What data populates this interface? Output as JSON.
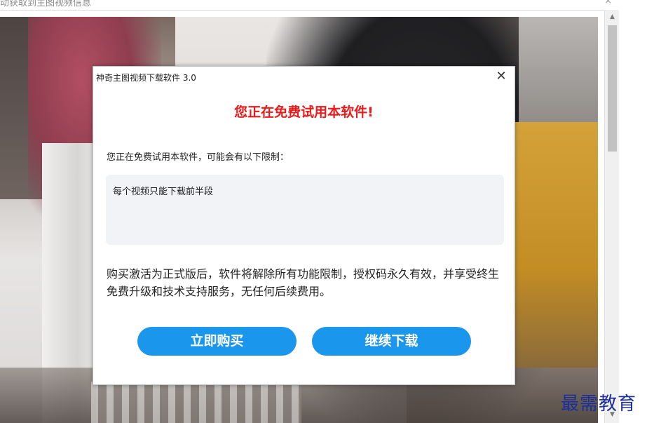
{
  "outer_window": {
    "title": "动获取到主图视频信息",
    "close_glyph": "×"
  },
  "scrollbar": {
    "up_glyph": "▲",
    "down_glyph": "▼"
  },
  "dialog": {
    "title": "神奇主图视频下载软件 3.0",
    "close_glyph": "✕",
    "headline": "您正在免费试用本软件!",
    "headline_color": "#ea1a1a",
    "intro": "您正在免费试用本软件，可能会有以下限制：",
    "limitations": "每个视频只能下载前半段",
    "purchase_note": "购买激活为正式版后，软件将解除所有功能限制，授权码永久有效，并享受终生免费升级和技术支持服务，无任何后续费用。",
    "buy_button": "立即购买",
    "continue_button": "继续下载",
    "button_color": "#1a96ec"
  },
  "watermark": "最需教育"
}
